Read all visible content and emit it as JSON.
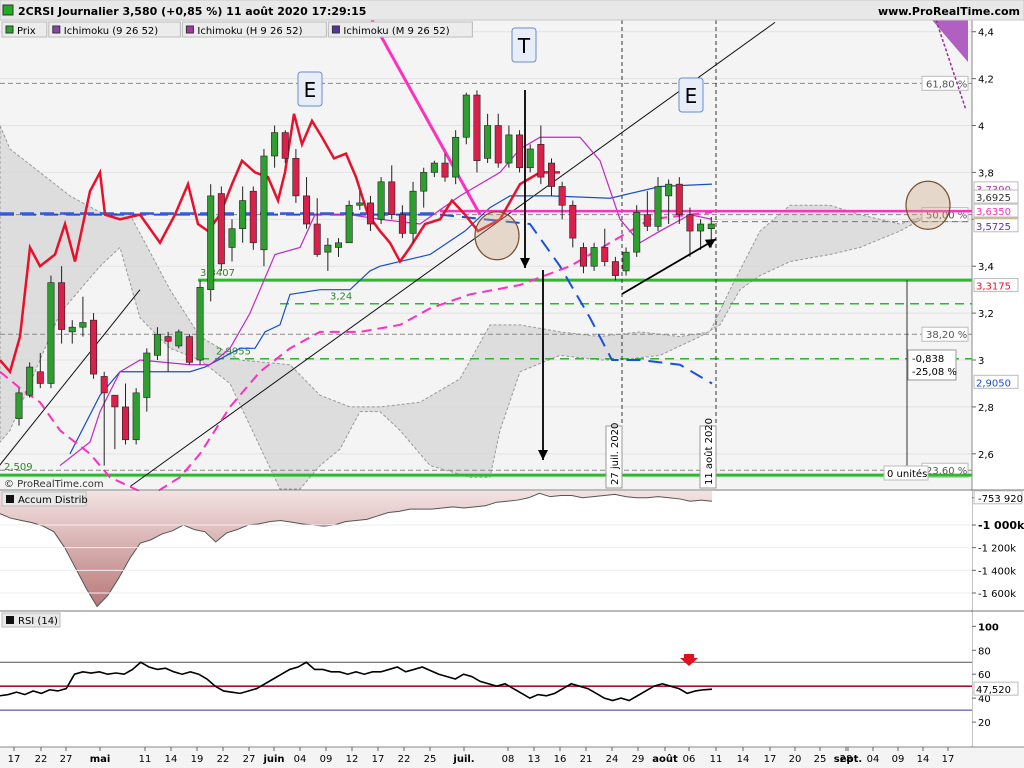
{
  "header": {
    "title": "2CRSI Journalier 3,580 (+0,85 %) 11 août 2020 17:29:15",
    "site": "www.ProRealTime.com",
    "watermark": "© ProRealTime.com"
  },
  "legend": [
    {
      "label": "Prix",
      "color": "#22aa22"
    },
    {
      "label": "Ichimoku (9 26 52)",
      "color": "#8844aa"
    },
    {
      "label": "Ichimoku (H 9 26 52)",
      "color": "#aa33aa"
    },
    {
      "label": "Ichimoku (M 9 26 52)",
      "color": "#5533aa"
    }
  ],
  "colors": {
    "up": "#2e9e2e",
    "down": "#d8204a",
    "tenkan": "#e8102a",
    "kijun_blue": "#1a4ec8",
    "magenta": "#ff2fbf",
    "support": "#2eb82e",
    "cloud": "#d6d6d6"
  },
  "chart_data": [
    {
      "type": "candlestick",
      "title": "2CRSI Journalier",
      "ylim": [
        2.45,
        4.45
      ],
      "yticks": [
        "4,4",
        "4,2",
        "4",
        "3,8",
        "3,6",
        "3,4",
        "3,2",
        "3",
        "2,8",
        "2,6"
      ],
      "x_labels": [
        "17",
        "22",
        "27",
        "mai",
        "11",
        "14",
        "19",
        "22",
        "27",
        "juin",
        "04",
        "09",
        "12",
        "17",
        "22",
        "25",
        "juil.",
        "08",
        "13",
        "16",
        "21",
        "24",
        "29",
        "août",
        "06",
        "11",
        "14",
        "17",
        "20",
        "25",
        "28",
        "sept.",
        "04",
        "09",
        "14",
        "17"
      ],
      "candles_ohlc": [
        [
          2.75,
          2.88,
          2.72,
          2.86
        ],
        [
          2.85,
          2.99,
          2.84,
          2.97
        ],
        [
          2.95,
          3.03,
          2.88,
          2.9
        ],
        [
          2.9,
          3.36,
          2.88,
          3.33
        ],
        [
          3.33,
          3.4,
          3.07,
          3.13
        ],
        [
          3.12,
          3.17,
          3.07,
          3.14
        ],
        [
          3.14,
          3.27,
          3.1,
          3.16
        ],
        [
          3.17,
          3.2,
          2.92,
          2.94
        ],
        [
          2.93,
          2.95,
          2.55,
          2.86
        ],
        [
          2.85,
          2.85,
          2.62,
          2.8
        ],
        [
          2.8,
          2.9,
          2.64,
          2.66
        ],
        [
          2.66,
          2.88,
          2.64,
          2.86
        ],
        [
          2.84,
          3.05,
          2.78,
          3.03
        ],
        [
          3.02,
          3.14,
          3.0,
          3.11
        ],
        [
          3.1,
          3.12,
          2.95,
          3.08
        ],
        [
          3.06,
          3.13,
          3.05,
          3.12
        ],
        [
          3.1,
          3.11,
          2.98,
          2.99
        ],
        [
          3.0,
          3.34,
          2.98,
          3.31
        ],
        [
          3.3,
          3.75,
          3.25,
          3.7
        ],
        [
          3.71,
          3.74,
          3.38,
          3.41
        ],
        [
          3.48,
          3.6,
          3.42,
          3.56
        ],
        [
          3.56,
          3.74,
          3.5,
          3.68
        ],
        [
          3.72,
          3.74,
          3.47,
          3.5
        ],
        [
          3.47,
          3.9,
          3.4,
          3.87
        ],
        [
          3.87,
          4.0,
          3.82,
          3.97
        ],
        [
          3.97,
          3.98,
          3.84,
          3.86
        ],
        [
          3.86,
          3.9,
          3.67,
          3.7
        ],
        [
          3.7,
          3.78,
          3.56,
          3.58
        ],
        [
          3.58,
          3.69,
          3.44,
          3.45
        ],
        [
          3.46,
          3.52,
          3.38,
          3.49
        ],
        [
          3.48,
          3.52,
          3.44,
          3.5
        ],
        [
          3.5,
          3.68,
          3.5,
          3.66
        ],
        [
          3.66,
          3.72,
          3.64,
          3.67
        ],
        [
          3.67,
          3.7,
          3.55,
          3.58
        ],
        [
          3.6,
          3.78,
          3.58,
          3.76
        ],
        [
          3.76,
          3.83,
          3.6,
          3.62
        ],
        [
          3.62,
          3.66,
          3.52,
          3.54
        ],
        [
          3.54,
          3.76,
          3.5,
          3.72
        ],
        [
          3.72,
          3.82,
          3.65,
          3.8
        ],
        [
          3.8,
          3.85,
          3.78,
          3.84
        ],
        [
          3.84,
          3.88,
          3.76,
          3.78
        ],
        [
          3.78,
          3.98,
          3.75,
          3.95
        ],
        [
          3.95,
          4.14,
          3.92,
          4.13
        ],
        [
          4.13,
          4.15,
          3.8,
          3.85
        ],
        [
          3.86,
          4.05,
          3.84,
          4.0
        ],
        [
          4.0,
          4.05,
          3.82,
          3.84
        ],
        [
          3.84,
          4.0,
          3.82,
          3.96
        ],
        [
          3.96,
          3.98,
          3.8,
          3.82
        ],
        [
          3.82,
          3.92,
          3.8,
          3.9
        ],
        [
          3.92,
          4.0,
          3.75,
          3.78
        ],
        [
          3.84,
          3.86,
          3.7,
          3.74
        ],
        [
          3.74,
          3.76,
          3.6,
          3.66
        ],
        [
          3.66,
          3.68,
          3.48,
          3.52
        ],
        [
          3.48,
          3.5,
          3.37,
          3.4
        ],
        [
          3.4,
          3.5,
          3.38,
          3.48
        ],
        [
          3.48,
          3.56,
          3.4,
          3.42
        ],
        [
          3.42,
          3.44,
          3.34,
          3.36
        ],
        [
          3.38,
          3.48,
          3.36,
          3.46
        ],
        [
          3.46,
          3.66,
          3.44,
          3.63
        ],
        [
          3.62,
          3.72,
          3.55,
          3.57
        ],
        [
          3.57,
          3.78,
          3.55,
          3.74
        ],
        [
          3.7,
          3.77,
          3.58,
          3.75
        ],
        [
          3.75,
          3.78,
          3.58,
          3.62
        ],
        [
          3.62,
          3.65,
          3.44,
          3.55
        ],
        [
          3.55,
          3.6,
          3.47,
          3.58
        ],
        [
          3.56,
          3.61,
          3.48,
          3.58
        ]
      ],
      "levels": [
        {
          "value": 3.3407,
          "label": "3,3407"
        },
        {
          "value": 3.24,
          "label": "3,24"
        },
        {
          "value": 3.0055,
          "label": "2,9955"
        },
        {
          "value": 2.509,
          "label": "2,509"
        }
      ],
      "fibonacci": [
        {
          "value": 4.18,
          "label": "61,80 %"
        },
        {
          "value": 3.62,
          "label": "50,00 %"
        },
        {
          "value": 3.11,
          "label": "38,20 %"
        },
        {
          "value": 2.53,
          "label": "23,60 %"
        }
      ],
      "price_badges": [
        {
          "value": 3.73,
          "label": "3,7390",
          "color": "#aa33aa",
          "bg": "#ffffff"
        },
        {
          "value": 3.695,
          "label": "3,6925",
          "color": "#333333",
          "bg": "#ffffff"
        },
        {
          "value": 3.635,
          "label": "3,6350",
          "color": "#ff2fbf",
          "bg": "#ffffff"
        },
        {
          "value": 3.58,
          "label": "3,580",
          "color": "#000000",
          "bg": "#f0c020"
        },
        {
          "value": 3.5725,
          "label": "3,5725",
          "color": "#5533aa",
          "bg": "#ffffff"
        },
        {
          "value": 3.3175,
          "label": "3,3175",
          "color": "#e8102a",
          "bg": "#ffffff"
        },
        {
          "value": 2.905,
          "label": "2,9050",
          "color": "#1a4ec8",
          "bg": "#ffffff"
        }
      ],
      "annotations": [
        {
          "text": "E"
        },
        {
          "text": "T"
        },
        {
          "text": "E"
        },
        {
          "text": "27 juil. 2020"
        },
        {
          "text": "11 août 2020"
        },
        {
          "text": "-0,838"
        },
        {
          "text": "-25,08 %"
        },
        {
          "text": "0 unités"
        }
      ]
    },
    {
      "type": "area",
      "title": "Accum Distrib",
      "yticks": [
        "-753 920",
        "-1 000k",
        "-1 200k",
        "-1 400k",
        "-1 600k"
      ],
      "last_value_label": "-753 920",
      "values": [
        -900,
        -940,
        -960,
        -980,
        -1010,
        -1060,
        -1200,
        -1380,
        -1560,
        -1720,
        -1620,
        -1470,
        -1300,
        -1160,
        -1130,
        -1080,
        -1050,
        -1000,
        -1040,
        -1060,
        -1150,
        -1070,
        -1040,
        -1000,
        -990,
        -970,
        -960,
        -975,
        -990,
        -1000,
        -1010,
        -1000,
        -970,
        -960,
        -950,
        -920,
        -890,
        -880,
        -860,
        -860,
        -860,
        -850,
        -840,
        -850,
        -840,
        -830,
        -800,
        -790,
        -780,
        -760,
        -720,
        -750,
        -740,
        -740,
        -760,
        -750,
        -740,
        -730,
        -750,
        -760,
        -760,
        -750,
        -760,
        -770,
        -790,
        -780,
        -790
      ]
    },
    {
      "type": "line",
      "title": "RSI (14)",
      "ylim": [
        0,
        112
      ],
      "yticks": [
        "100",
        "80",
        "60",
        "40",
        "20"
      ],
      "last_value_label": "47,520",
      "reference_lines": [
        70,
        50,
        30
      ],
      "values": [
        42,
        43,
        45,
        43,
        46,
        44,
        47,
        46,
        48,
        60,
        62,
        61,
        62,
        60,
        61,
        60,
        64,
        70,
        66,
        64,
        65,
        62,
        60,
        62,
        60,
        56,
        50,
        46,
        45,
        44,
        46,
        48,
        52,
        56,
        60,
        64,
        66,
        70,
        64,
        64,
        62,
        62,
        60,
        62,
        60,
        62,
        62,
        64,
        66,
        62,
        64,
        66,
        63,
        60,
        58,
        56,
        60,
        58,
        54,
        52,
        50,
        52,
        48,
        44,
        40,
        43,
        42,
        44,
        48,
        52,
        50,
        48,
        44,
        40,
        38,
        40,
        38,
        42,
        46,
        50,
        52,
        50,
        48,
        44,
        46,
        47,
        47.5
      ]
    }
  ]
}
